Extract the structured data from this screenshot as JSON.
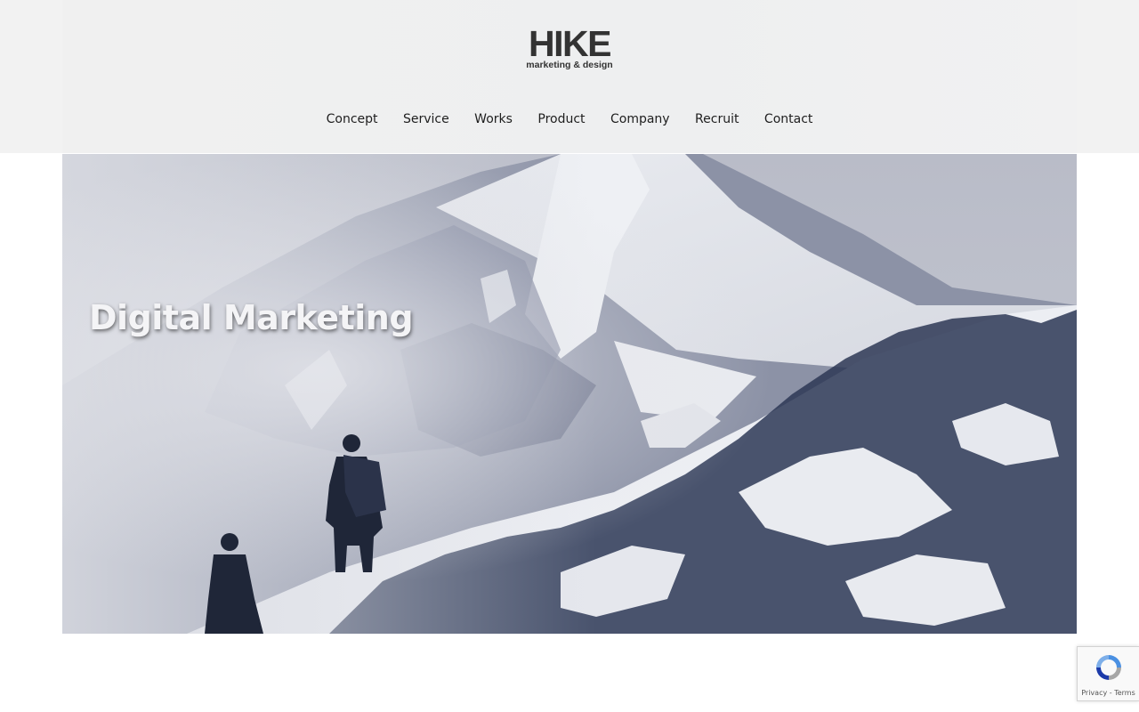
{
  "logo": {
    "main": "HIKE",
    "sub": "marketing & design"
  },
  "nav": {
    "items": [
      {
        "label": "Concept"
      },
      {
        "label": "Service"
      },
      {
        "label": "Works"
      },
      {
        "label": "Product"
      },
      {
        "label": "Company"
      },
      {
        "label": "Recruit"
      },
      {
        "label": "Contact"
      }
    ]
  },
  "hero": {
    "title": "Digital Marketing"
  },
  "recaptcha": {
    "icon": "recaptcha-icon",
    "privacy_label": "Privacy",
    "separator": "-",
    "terms_label": "Terms"
  },
  "colors": {
    "header_bg": "#f0f0f0",
    "nav_text": "#1e1e1e",
    "logo_text": "#333333",
    "hero_text": "#f4f4f6",
    "hero_tint": "#2a3552"
  }
}
